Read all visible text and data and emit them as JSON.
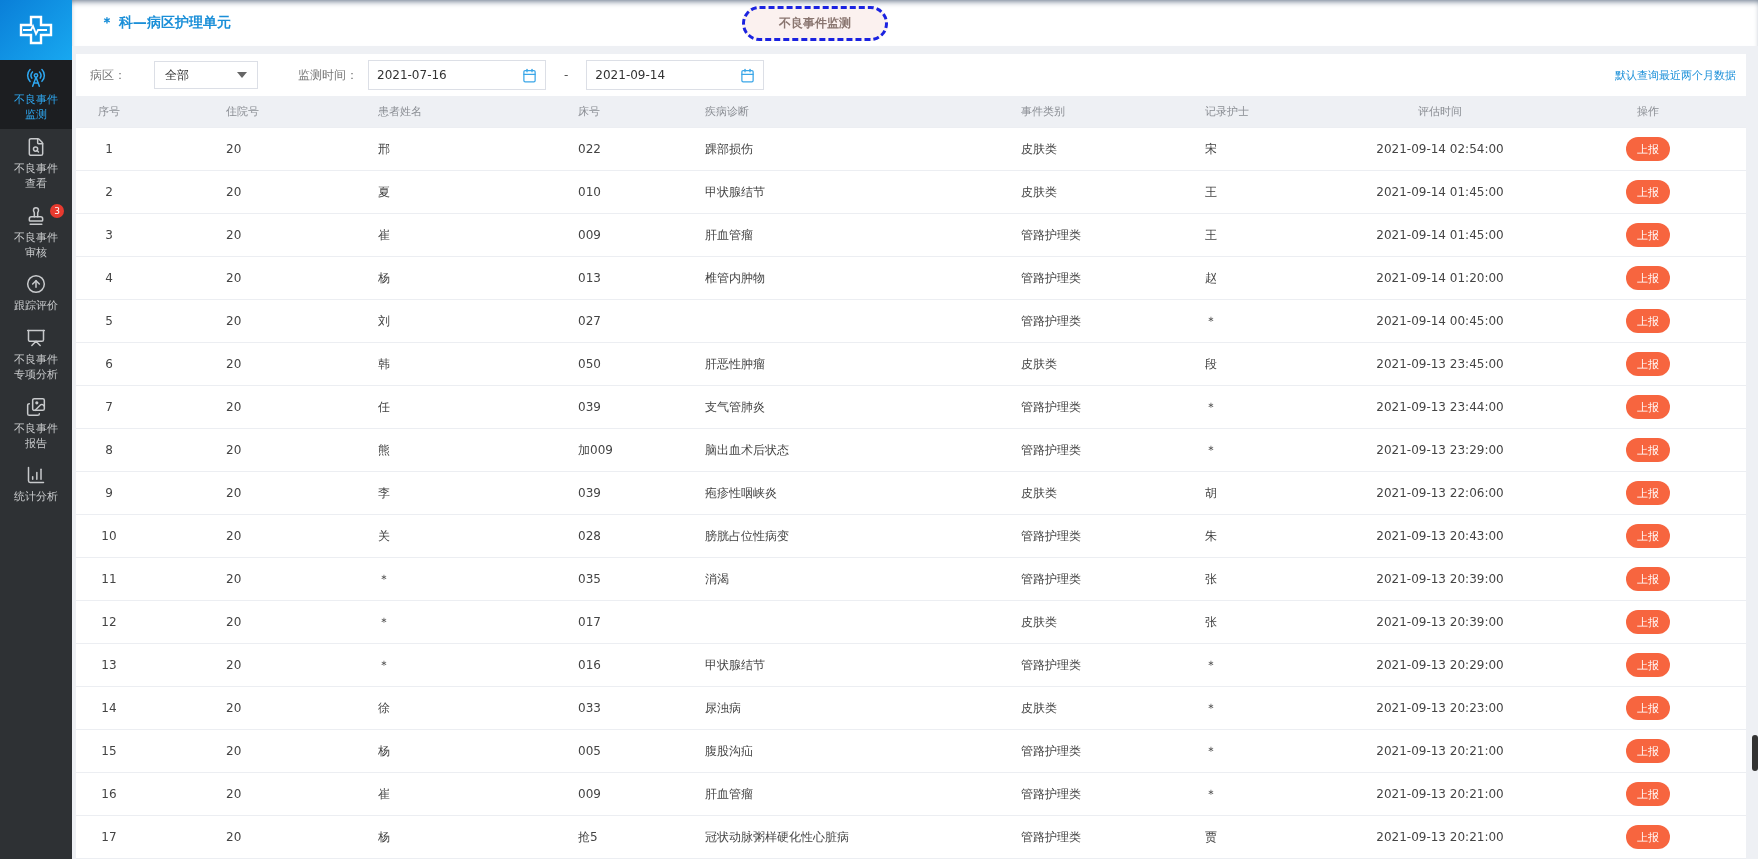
{
  "sidebar": {
    "items": [
      {
        "label": "不良事件监测",
        "selected": true
      },
      {
        "label": "不良事件查看",
        "selected": false
      },
      {
        "label": "不良事件审核",
        "selected": false,
        "badge": "3"
      },
      {
        "label": "跟踪评价",
        "selected": false
      },
      {
        "label": "不良事件专项分析",
        "selected": false
      },
      {
        "label": "不良事件报告",
        "selected": false
      },
      {
        "label": "统计分析",
        "selected": false
      }
    ]
  },
  "header": {
    "title": "＊ 科—病区护理单元",
    "tab": "不良事件监测"
  },
  "filters": {
    "ward_label": "病区：",
    "ward_value": "全部",
    "time_label": "监测时间：",
    "start_date": "2021-07-16",
    "separator": "-",
    "end_date": "2021-09-14",
    "hint": "默认查询最近两个月数据"
  },
  "table": {
    "columns": [
      "序号",
      "住院号",
      "患者姓名",
      "床号",
      "疾病诊断",
      "事件类别",
      "记录护士",
      "评估时间",
      "操作"
    ],
    "rows": [
      {
        "no": "1",
        "admission_no": "20",
        "name": "邢",
        "bed": "022",
        "diagnosis": "踝部损伤",
        "category": "皮肤类",
        "nurse": "宋",
        "time": "2021-09-14 02:54:00",
        "action": "上报"
      },
      {
        "no": "2",
        "admission_no": "20",
        "name": "夏",
        "bed": "010",
        "diagnosis": "甲状腺结节",
        "category": "皮肤类",
        "nurse": "王",
        "time": "2021-09-14 01:45:00",
        "action": "上报"
      },
      {
        "no": "3",
        "admission_no": "20",
        "name": "崔",
        "bed": "009",
        "diagnosis": "肝血管瘤",
        "category": "管路护理类",
        "nurse": "王",
        "time": "2021-09-14 01:45:00",
        "action": "上报"
      },
      {
        "no": "4",
        "admission_no": "20",
        "name": "杨",
        "bed": "013",
        "diagnosis": "椎管内肿物",
        "category": "管路护理类",
        "nurse": "赵",
        "time": "2021-09-14 01:20:00",
        "action": "上报"
      },
      {
        "no": "5",
        "admission_no": "20",
        "name": "刘",
        "bed": "027",
        "category": "管路护理类",
        "nurse": "＊",
        "time": "2021-09-14 00:45:00",
        "action": "上报"
      },
      {
        "no": "6",
        "admission_no": "20",
        "name": "韩",
        "bed": "050",
        "diagnosis": "肝恶性肿瘤",
        "category": "皮肤类",
        "nurse": "段",
        "time": "2021-09-13 23:45:00",
        "action": "上报"
      },
      {
        "no": "7",
        "admission_no": "20",
        "name": "任",
        "bed": "039",
        "diagnosis": "支气管肺炎",
        "category": "管路护理类",
        "nurse": "＊",
        "time": "2021-09-13 23:44:00",
        "action": "上报"
      },
      {
        "no": "8",
        "admission_no": "20",
        "name": "熊",
        "bed": "加009",
        "diagnosis": "脑出血术后状态",
        "category": "管路护理类",
        "nurse": "＊",
        "time": "2021-09-13 23:29:00",
        "action": "上报"
      },
      {
        "no": "9",
        "admission_no": "20",
        "name": "李",
        "bed": "039",
        "diagnosis": "疱疹性咽峡炎",
        "category": "皮肤类",
        "nurse": "胡",
        "time": "2021-09-13 22:06:00",
        "action": "上报"
      },
      {
        "no": "10",
        "admission_no": "20",
        "name": "关",
        "bed": "028",
        "diagnosis": "膀胱占位性病变",
        "category": "管路护理类",
        "nurse": "朱",
        "time": "2021-09-13 20:43:00",
        "action": "上报"
      },
      {
        "no": "11",
        "admission_no": "20",
        "name": "＊",
        "bed": "035",
        "diagnosis": "消渴",
        "category": "管路护理类",
        "nurse": "张",
        "time": "2021-09-13 20:39:00",
        "action": "上报"
      },
      {
        "no": "12",
        "admission_no": "20",
        "name": "＊",
        "bed": "017",
        "category": "皮肤类",
        "nurse": "张",
        "time": "2021-09-13 20:39:00",
        "action": "上报"
      },
      {
        "no": "13",
        "admission_no": "20",
        "name": "＊",
        "bed": "016",
        "diagnosis": "甲状腺结节",
        "category": "管路护理类",
        "nurse": "＊",
        "time": "2021-09-13 20:29:00",
        "action": "上报"
      },
      {
        "no": "14",
        "admission_no": "20",
        "name": "徐",
        "bed": "033",
        "diagnosis": "尿浊病",
        "category": "皮肤类",
        "nurse": "＊",
        "time": "2021-09-13 20:23:00",
        "action": "上报"
      },
      {
        "no": "15",
        "admission_no": "20",
        "name": "杨",
        "bed": "005",
        "diagnosis": "腹股沟疝",
        "category": "管路护理类",
        "nurse": "＊",
        "time": "2021-09-13 20:21:00",
        "action": "上报"
      },
      {
        "no": "16",
        "admission_no": "20",
        "name": "崔",
        "bed": "009",
        "diagnosis": "肝血管瘤",
        "category": "管路护理类",
        "nurse": "＊",
        "time": "2021-09-13 20:21:00",
        "action": "上报"
      },
      {
        "no": "17",
        "admission_no": "20",
        "name": "杨",
        "bed": "抢5",
        "diagnosis": "冠状动脉粥样硬化性心脏病",
        "category": "管路护理类",
        "nurse": "贾",
        "time": "2021-09-13 20:21:00",
        "action": "上报"
      }
    ]
  }
}
